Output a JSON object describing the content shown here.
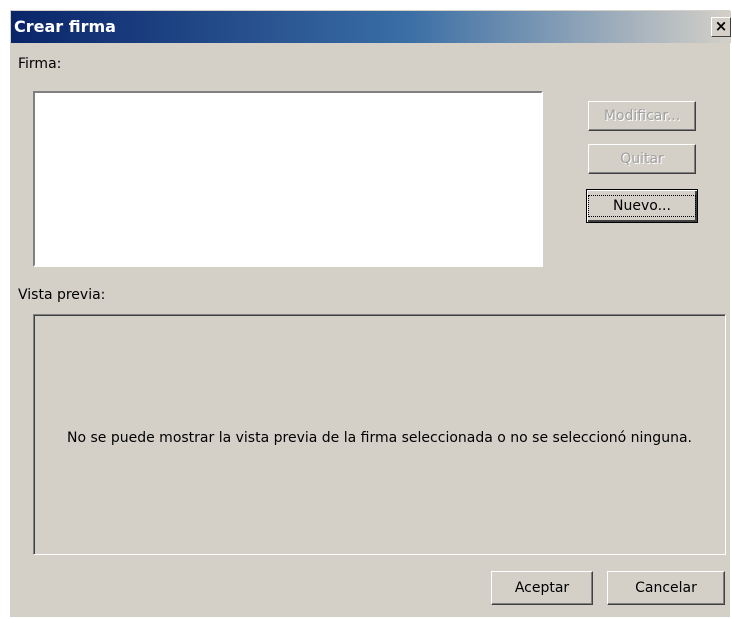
{
  "window": {
    "title": "Crear firma",
    "close_glyph": "×"
  },
  "signature": {
    "label": "Firma:",
    "items": []
  },
  "buttons": {
    "modify": "Modificar...",
    "remove": "Quitar",
    "new": "Nuevo...",
    "ok": "Aceptar",
    "cancel": "Cancelar"
  },
  "preview": {
    "label": "Vista previa:",
    "message": "No se puede mostrar la vista previa de la firma seleccionada o no se seleccionó ninguna."
  }
}
